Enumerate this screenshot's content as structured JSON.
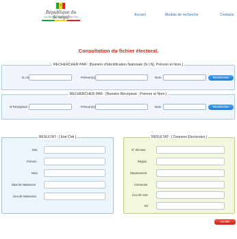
{
  "logo": {
    "title": "République du Sénégal",
    "motto": "un Peuple - un But - une Foi"
  },
  "nav": {
    "accueil": "Accueil",
    "module": "Module de recherche",
    "contacts": "Contacts"
  },
  "page_title": "Consultation du fichier électoral.",
  "search_nin": {
    "legend": "RECHERCHER PAR : [Numéro d'Identification Nationale (N.I.N), Prénom et Nom ]",
    "nin_label": "N.I.N",
    "prenom_label": "Prénom(s)",
    "nom_label": "Nom",
    "nin_value": "",
    "prenom_value": "",
    "nom_value": "",
    "button": "Rechercher"
  },
  "search_recepisse": {
    "legend": "RECHERCHER PAR : [Numéro Récépissé , Prénom et Nom ]",
    "recepisse_label": "N°Récépissé",
    "prenom_label": "Prénom(s)",
    "nom_label": "Nom",
    "recepisse_value": "",
    "prenom_value": "",
    "nom_value": "",
    "button": "Rechercher"
  },
  "etat_civil": {
    "legend": "RESULTAT : [ Etat Civil ]",
    "fields": [
      "NIN",
      "Prénom",
      "Nom",
      "Date de Naissance",
      "Lieu de Naissance"
    ]
  },
  "electorales": {
    "legend": "RESULTAT : [ Données Electorales ]",
    "fields": [
      "N° électeur",
      "Région",
      "Département",
      "Commune",
      "Lieu de vote",
      "BV"
    ]
  },
  "reset_button": "Annuler",
  "colors": {
    "title": "#cc2a1a",
    "link": "#2d6fa8",
    "button": "#1f79cf",
    "reset": "#cc1e12",
    "civil_bg": "#ecf5fc",
    "electorales_bg": "#f3f8dc"
  }
}
